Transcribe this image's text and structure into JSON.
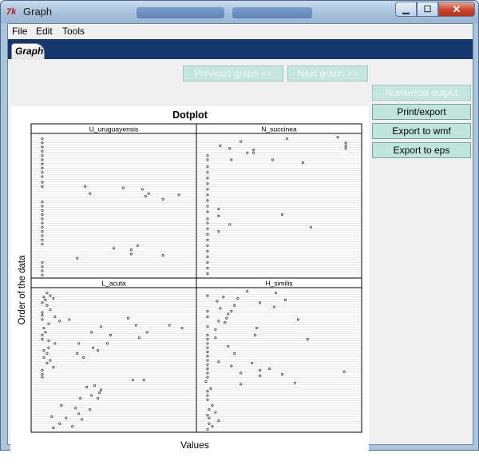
{
  "window": {
    "title": "Graph",
    "icon": "tk-feather-icon"
  },
  "menu": {
    "items": [
      "File",
      "Edit",
      "Tools"
    ]
  },
  "tabs": [
    {
      "label": "Graph"
    }
  ],
  "nav": {
    "previous_label": "Previous graph <<",
    "next_label": "Next graph >>"
  },
  "side_buttons": {
    "numerical_output": "Numerical output",
    "print_export": "Print/export",
    "export_wmf": "Export to wmf",
    "export_eps": "Export to eps"
  },
  "colors": {
    "button_bg": "#bfe5dc",
    "tab_strip": "#16376e"
  },
  "chart_data": {
    "type": "scatter",
    "title": "Dotplot",
    "xlabel": "Values",
    "ylabel": "Order of the data",
    "grid": true,
    "panels": [
      {
        "name": "U_uruguayensis",
        "points": [
          [
            0.05,
            0.02
          ],
          [
            0.05,
            0.05
          ],
          [
            0.05,
            0.08
          ],
          [
            0.05,
            0.11
          ],
          [
            0.05,
            0.14
          ],
          [
            0.05,
            0.17
          ],
          [
            0.05,
            0.2
          ],
          [
            0.05,
            0.23
          ],
          [
            0.05,
            0.26
          ],
          [
            0.05,
            0.29
          ],
          [
            0.05,
            0.33
          ],
          [
            0.05,
            0.36
          ],
          [
            0.32,
            0.36
          ],
          [
            0.35,
            0.41
          ],
          [
            0.56,
            0.37
          ],
          [
            0.68,
            0.38
          ],
          [
            0.72,
            0.41
          ],
          [
            0.7,
            0.43
          ],
          [
            0.81,
            0.45
          ],
          [
            0.91,
            0.42
          ],
          [
            0.05,
            0.47
          ],
          [
            0.05,
            0.5
          ],
          [
            0.05,
            0.53
          ],
          [
            0.05,
            0.56
          ],
          [
            0.05,
            0.59
          ],
          [
            0.05,
            0.62
          ],
          [
            0.05,
            0.65
          ],
          [
            0.05,
            0.68
          ],
          [
            0.05,
            0.71
          ],
          [
            0.05,
            0.74
          ],
          [
            0.05,
            0.77
          ],
          [
            0.5,
            0.8
          ],
          [
            0.65,
            0.78
          ],
          [
            0.61,
            0.81
          ],
          [
            0.61,
            0.84
          ],
          [
            0.81,
            0.85
          ],
          [
            0.27,
            0.87
          ],
          [
            0.05,
            0.9
          ],
          [
            0.05,
            0.93
          ],
          [
            0.05,
            0.96
          ],
          [
            0.05,
            0.99
          ]
        ]
      },
      {
        "name": "N_succinea",
        "points": [
          [
            0.13,
            0.07
          ],
          [
            0.26,
            0.04
          ],
          [
            0.19,
            0.09
          ],
          [
            0.3,
            0.12
          ],
          [
            0.34,
            0.1
          ],
          [
            0.34,
            0.12
          ],
          [
            0.2,
            0.17
          ],
          [
            0.55,
            0.02
          ],
          [
            0.87,
            0.01
          ],
          [
            0.92,
            0.05
          ],
          [
            0.92,
            0.07
          ],
          [
            0.92,
            0.09
          ],
          [
            0.05,
            0.14
          ],
          [
            0.05,
            0.17
          ],
          [
            0.46,
            0.17
          ],
          [
            0.65,
            0.19
          ],
          [
            0.05,
            0.22
          ],
          [
            0.05,
            0.26
          ],
          [
            0.05,
            0.3
          ],
          [
            0.05,
            0.34
          ],
          [
            0.05,
            0.38
          ],
          [
            0.05,
            0.42
          ],
          [
            0.05,
            0.46
          ],
          [
            0.05,
            0.5
          ],
          [
            0.05,
            0.54
          ],
          [
            0.12,
            0.52
          ],
          [
            0.12,
            0.57
          ],
          [
            0.52,
            0.56
          ],
          [
            0.19,
            0.63
          ],
          [
            0.7,
            0.65
          ],
          [
            0.05,
            0.59
          ],
          [
            0.05,
            0.62
          ],
          [
            0.12,
            0.68
          ],
          [
            0.05,
            0.66
          ],
          [
            0.05,
            0.7
          ],
          [
            0.05,
            0.74
          ],
          [
            0.05,
            0.78
          ],
          [
            0.05,
            0.82
          ],
          [
            0.05,
            0.86
          ],
          [
            0.05,
            0.9
          ],
          [
            0.05,
            0.94
          ],
          [
            0.05,
            0.98
          ]
        ]
      },
      {
        "name": "L_acuta",
        "points": [
          [
            0.08,
            0.02
          ],
          [
            0.1,
            0.04
          ],
          [
            0.06,
            0.05
          ],
          [
            0.12,
            0.06
          ],
          [
            0.07,
            0.07
          ],
          [
            0.05,
            0.09
          ],
          [
            0.08,
            0.11
          ],
          [
            0.1,
            0.14
          ],
          [
            0.05,
            0.16
          ],
          [
            0.05,
            0.18
          ],
          [
            0.13,
            0.19
          ],
          [
            0.05,
            0.21
          ],
          [
            0.16,
            0.22
          ],
          [
            0.22,
            0.21
          ],
          [
            0.09,
            0.24
          ],
          [
            0.06,
            0.27
          ],
          [
            0.07,
            0.3
          ],
          [
            0.05,
            0.32
          ],
          [
            0.05,
            0.35
          ],
          [
            0.09,
            0.36
          ],
          [
            0.13,
            0.38
          ],
          [
            0.09,
            0.41
          ],
          [
            0.06,
            0.43
          ],
          [
            0.08,
            0.45
          ],
          [
            0.06,
            0.48
          ],
          [
            0.1,
            0.5
          ],
          [
            0.08,
            0.52
          ],
          [
            0.12,
            0.55
          ],
          [
            0.05,
            0.57
          ],
          [
            0.05,
            0.6
          ],
          [
            0.05,
            0.62
          ],
          [
            0.28,
            0.38
          ],
          [
            0.37,
            0.41
          ],
          [
            0.36,
            0.3
          ],
          [
            0.42,
            0.26
          ],
          [
            0.48,
            0.32
          ],
          [
            0.59,
            0.2
          ],
          [
            0.64,
            0.25
          ],
          [
            0.71,
            0.3
          ],
          [
            0.66,
            0.34
          ],
          [
            0.85,
            0.25
          ],
          [
            0.93,
            0.27
          ],
          [
            0.27,
            0.45
          ],
          [
            0.31,
            0.48
          ],
          [
            0.46,
            0.38
          ],
          [
            0.4,
            0.43
          ],
          [
            0.62,
            0.64
          ],
          [
            0.69,
            0.64
          ],
          [
            0.42,
            0.71
          ],
          [
            0.41,
            0.73
          ],
          [
            0.33,
            0.69
          ],
          [
            0.38,
            0.68
          ],
          [
            0.36,
            0.75
          ],
          [
            0.29,
            0.77
          ],
          [
            0.4,
            0.77
          ],
          [
            0.17,
            0.82
          ],
          [
            0.26,
            0.84
          ],
          [
            0.35,
            0.85
          ],
          [
            0.28,
            0.88
          ],
          [
            0.2,
            0.91
          ],
          [
            0.11,
            0.9
          ],
          [
            0.3,
            0.92
          ],
          [
            0.16,
            0.95
          ],
          [
            0.24,
            0.97
          ],
          [
            0.12,
            0.98
          ]
        ]
      },
      {
        "name": "H_similis",
        "points": [
          [
            0.3,
            0.01
          ],
          [
            0.48,
            0.02
          ],
          [
            0.05,
            0.04
          ],
          [
            0.15,
            0.05
          ],
          [
            0.24,
            0.06
          ],
          [
            0.11,
            0.08
          ],
          [
            0.54,
            0.07
          ],
          [
            0.38,
            0.09
          ],
          [
            0.22,
            0.11
          ],
          [
            0.47,
            0.12
          ],
          [
            0.13,
            0.13
          ],
          [
            0.05,
            0.15
          ],
          [
            0.2,
            0.15
          ],
          [
            0.18,
            0.17
          ],
          [
            0.05,
            0.19
          ],
          [
            0.17,
            0.2
          ],
          [
            0.12,
            0.22
          ],
          [
            0.16,
            0.23
          ],
          [
            0.05,
            0.26
          ],
          [
            0.1,
            0.28
          ],
          [
            0.62,
            0.21
          ],
          [
            0.68,
            0.35
          ],
          [
            0.36,
            0.27
          ],
          [
            0.35,
            0.32
          ],
          [
            0.05,
            0.32
          ],
          [
            0.05,
            0.35
          ],
          [
            0.05,
            0.38
          ],
          [
            0.05,
            0.41
          ],
          [
            0.18,
            0.4
          ],
          [
            0.05,
            0.44
          ],
          [
            0.05,
            0.47
          ],
          [
            0.05,
            0.5
          ],
          [
            0.05,
            0.53
          ],
          [
            0.05,
            0.56
          ],
          [
            0.05,
            0.59
          ],
          [
            0.05,
            0.62
          ],
          [
            0.1,
            0.34
          ],
          [
            0.22,
            0.45
          ],
          [
            0.12,
            0.51
          ],
          [
            0.2,
            0.54
          ],
          [
            0.33,
            0.52
          ],
          [
            0.44,
            0.56
          ],
          [
            0.38,
            0.57
          ],
          [
            0.26,
            0.59
          ],
          [
            0.38,
            0.61
          ],
          [
            0.52,
            0.6
          ],
          [
            0.6,
            0.66
          ],
          [
            0.91,
            0.58
          ],
          [
            0.04,
            0.65
          ],
          [
            0.26,
            0.67
          ],
          [
            0.07,
            0.7
          ],
          [
            0.05,
            0.72
          ],
          [
            0.05,
            0.75
          ],
          [
            0.05,
            0.78
          ],
          [
            0.08,
            0.82
          ],
          [
            0.06,
            0.85
          ],
          [
            0.1,
            0.87
          ],
          [
            0.05,
            0.89
          ],
          [
            0.06,
            0.91
          ],
          [
            0.12,
            0.93
          ],
          [
            0.06,
            0.95
          ],
          [
            0.08,
            0.97
          ],
          [
            0.05,
            0.99
          ]
        ]
      }
    ]
  }
}
